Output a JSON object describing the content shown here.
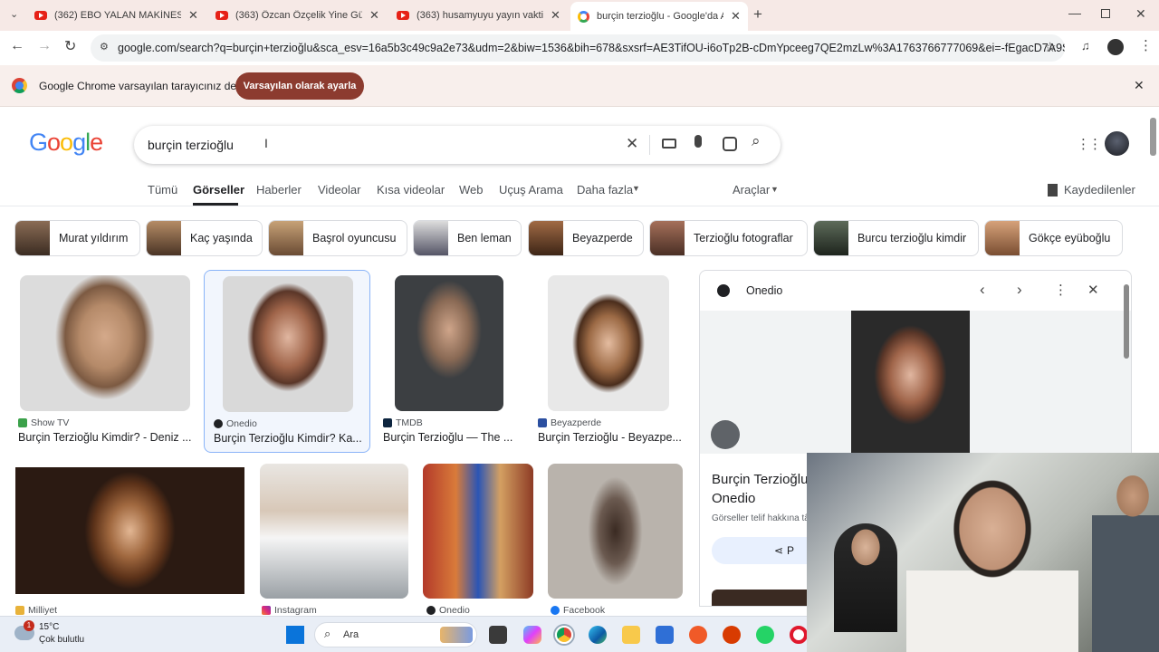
{
  "browser": {
    "tabs": [
      {
        "title": "(362) EBO YALAN MAKİNESİNDE",
        "type": "youtube"
      },
      {
        "title": "(363) Özcan Özçelik Yine Güldü",
        "type": "youtube"
      },
      {
        "title": "(363) husamyuyu yayın vakti 10",
        "type": "youtube"
      },
      {
        "title": "burçin terzioğlu - Google'da Ara",
        "type": "google"
      }
    ],
    "url": "google.com/search?q=burçin+terzioğlu&sca_esv=16a5b3c49c9a2e73&udm=2&biw=1536&bih=678&sxsrf=AE3TifOU-i6oTp2B-cDmYpceeg7QE2mzLw%3A1763766777069&ei=-fEgacD7A9SIxc8P...",
    "notice": {
      "text": "Google Chrome varsayılan tarayıcınız değil",
      "button": "Varsayılan olarak ayarla"
    }
  },
  "google": {
    "logo": "Google",
    "query": "burçin terzioğlu",
    "nav": [
      "Tümü",
      "Görseller",
      "Haberler",
      "Videolar",
      "Kısa videolar",
      "Web",
      "Uçuş Arama",
      "Daha fazla"
    ],
    "tools": "Araçlar",
    "saved": "Kaydedilenler",
    "chips": [
      "Murat yıldırım",
      "Kaç yaşında",
      "Başrol oyuncusu",
      "Ben leman",
      "Beyazperde",
      "Terzioğlu fotograflar",
      "Burcu terzioğlu kimdir",
      "Gökçe eyüboğlu"
    ],
    "results_row1": [
      {
        "source": "Show TV",
        "title": "Burçin Terzioğlu Kimdir? - Deniz ...",
        "fav": "#3ba14a"
      },
      {
        "source": "Onedio",
        "title": "Burçin Terzioğlu Kimdir? Ka...",
        "fav": "#202124"
      },
      {
        "source": "TMDB",
        "title": "Burçin Terzioğlu — The ...",
        "fav": "#0d253f"
      },
      {
        "source": "Beyazperde",
        "title": "Burçin Terzioğlu - Beyazpe...",
        "fav": "#2b4fa0"
      }
    ],
    "results_row2_sources": [
      "Milliyet",
      "Instagram",
      "Onedio",
      "Facebook"
    ],
    "panel": {
      "source": "Onedio",
      "title_line1": "Burçin Terzioğlu",
      "title_line2": "Onedio",
      "note": "Görseller telif hakkına tâ",
      "share": "P"
    }
  },
  "taskbar": {
    "badge": "1",
    "temperature": "15°C",
    "weather": "Çok bulutlu",
    "search": "Ara"
  }
}
